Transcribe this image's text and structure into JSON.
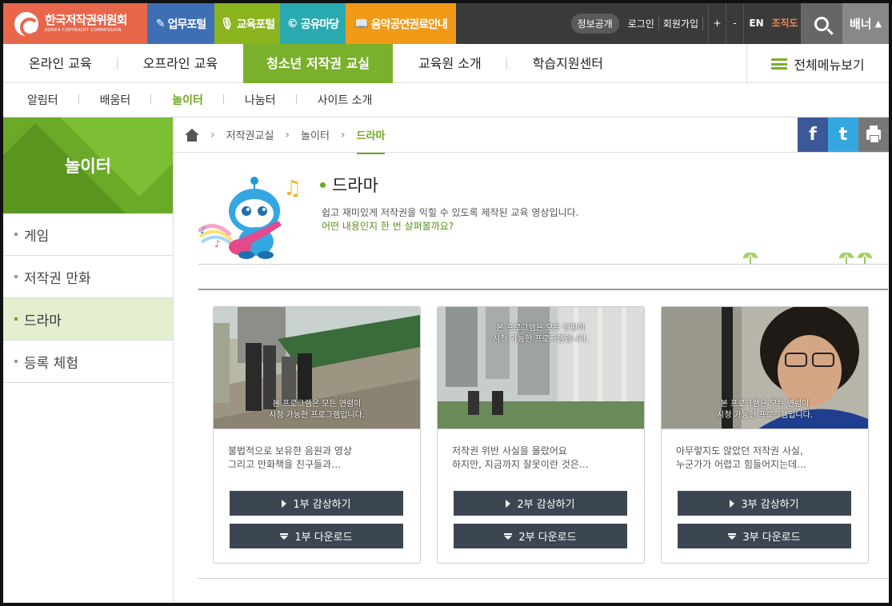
{
  "header": {
    "logo_main": "한국저작권위원회",
    "logo_sub": "KOREA COPYRIGHT COMMISSION",
    "portals": [
      {
        "label": "업무포털",
        "color": "#3e6fb5"
      },
      {
        "label": "교육포털",
        "color": "#8cb41f"
      },
      {
        "label": "공유마당",
        "color": "#29aab0"
      },
      {
        "label": "음악공연권료안내",
        "color": "#f19a18"
      }
    ],
    "util": {
      "info": "정보공개",
      "login": "로그인",
      "join": "회원가입",
      "plus": "+",
      "minus": "-",
      "en": "EN",
      "org": "조직도",
      "banner": "배너"
    }
  },
  "gnb": {
    "items": [
      "온라인 교육",
      "오프라인 교육",
      "청소년 저작권 교실",
      "교육원 소개",
      "학습지원센터"
    ],
    "active_index": 2,
    "all_menu": "전체메뉴보기"
  },
  "snb": {
    "items": [
      "알림터",
      "배움터",
      "놀이터",
      "나눔터",
      "사이트 소개"
    ],
    "active_index": 2
  },
  "lnb": {
    "title": "놀이터",
    "items": [
      "게임",
      "저작권 만화",
      "드라마",
      "등록 체험"
    ],
    "active_index": 2
  },
  "breadcrumb": {
    "items": [
      "저작권교실",
      "놀이터",
      "드라마"
    ]
  },
  "sns": {
    "facebook": "f",
    "twitter": "t"
  },
  "content": {
    "title": "드라마",
    "desc1": "쉽고 재미있게 저작권을 익힐 수 있도록 제작된 교육 영상입니다.",
    "desc2": "어떤 내용인지 한 번 살펴볼까요?",
    "videos": [
      {
        "caption1": "본 프로그램은 모든 연령이",
        "caption2": "시청 가능한 프로그램입니다.",
        "text1": "불법적으로 보유한 음원과 영상",
        "text2": "그리고 만화책을 친구들과…",
        "view": "1부 감상하기",
        "download": "1부 다운로드"
      },
      {
        "caption1": "본 프로그램은 모든 연령이",
        "caption2": "시청 가능한 프로그램입니다.",
        "text1": "저작권 위반 사실을 몰랐어요",
        "text2": "하지만, 지금까지 잘못이란 것은…",
        "view": "2부 감상하기",
        "download": "2부 다운로드"
      },
      {
        "caption1": "본 프로그램은 모든 연령이",
        "caption2": "시청 가능한 프로그램입니다.",
        "text1": "아무렇지도 않았던 저작권 사실,",
        "text2": "누군가가 어렵고 힘들어지는데…",
        "view": "3부 감상하기",
        "download": "3부 다운로드"
      }
    ]
  }
}
